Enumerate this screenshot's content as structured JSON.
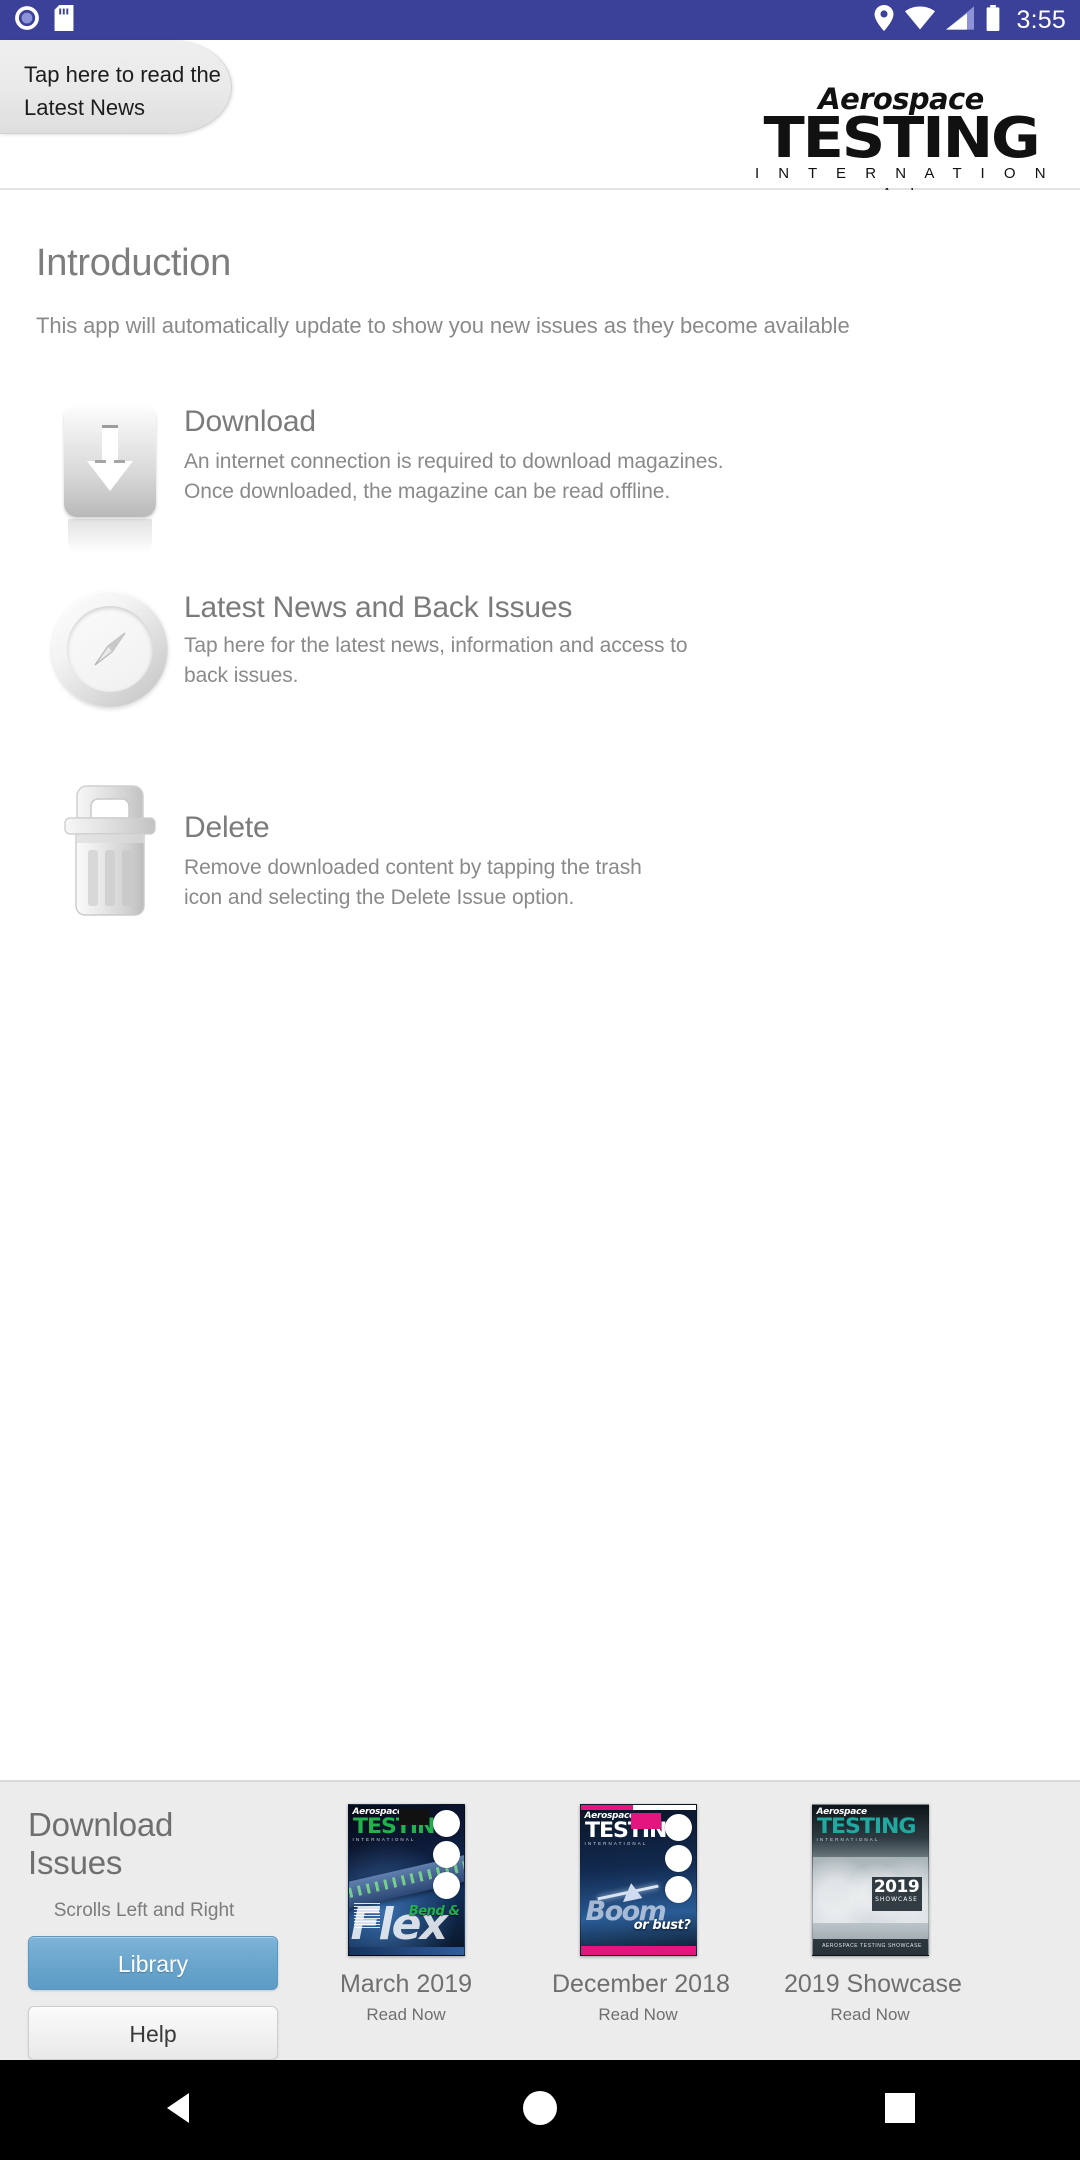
{
  "status_bar": {
    "time": "3:55",
    "icons_left": [
      "record-indicator-icon",
      "sd-card-icon"
    ],
    "icons_right": [
      "location-icon",
      "wifi-icon",
      "cellular-signal-icon",
      "battery-icon"
    ],
    "background_color": "#3b4099"
  },
  "header": {
    "news_tab": {
      "line1": "Tap here to read the",
      "line2": "Latest News"
    },
    "logo": {
      "top": "Aerospace",
      "main": "TESTING",
      "sub": "I N T E R N A T I O N A L"
    }
  },
  "main": {
    "title": "Introduction",
    "subtitle": "This app will automatically update to show you new issues as they become available",
    "features": [
      {
        "icon": "download-arrow-icon",
        "title": "Download",
        "description": "An internet connection is required to download magazines. Once downloaded, the magazine can be read offline."
      },
      {
        "icon": "compass-icon",
        "title": "Latest News and Back Issues",
        "description": "Tap here for the latest news, information and access to back issues."
      },
      {
        "icon": "trash-icon",
        "title": "Delete",
        "description": "Remove downloaded content by tapping the trash icon and selecting the Delete Issue option."
      }
    ]
  },
  "shelf": {
    "title": "Download Issues",
    "hint": "Scrolls Left and Right",
    "library_label": "Library",
    "help_label": "Help",
    "accent_color": "#6aa6cd",
    "issues": [
      {
        "name": "March 2019",
        "action": "Read Now",
        "cover": {
          "masthead_top": "Aerospace",
          "masthead_main": "TESTING",
          "masthead_sub": "INTERNATIONAL",
          "headline_small": "Bend &",
          "headline_large": "Flex",
          "masthead_color": "#21b24b"
        }
      },
      {
        "name": "December 2018",
        "action": "Read Now",
        "cover": {
          "masthead_top": "Aerospace",
          "masthead_main": "TESTING",
          "masthead_sub": "INTERNATIONAL",
          "headline_small": "or bust?",
          "headline_large": "Boom",
          "masthead_color": "#ffffff"
        }
      },
      {
        "name": "2019 Showcase",
        "action": "Read Now",
        "cover": {
          "masthead_top": "Aerospace",
          "masthead_main": "TESTING",
          "masthead_sub": "INTERNATIONAL",
          "badge_year": "2019",
          "badge_label": "SHOWCASE",
          "strip_text": "AEROSPACE TESTING SHOWCASE",
          "masthead_color": "#1fa9a0"
        }
      }
    ]
  },
  "nav_bar": {
    "back_label": "back-triangle-icon",
    "home_label": "home-circle-icon",
    "recents_label": "recents-square-icon"
  }
}
